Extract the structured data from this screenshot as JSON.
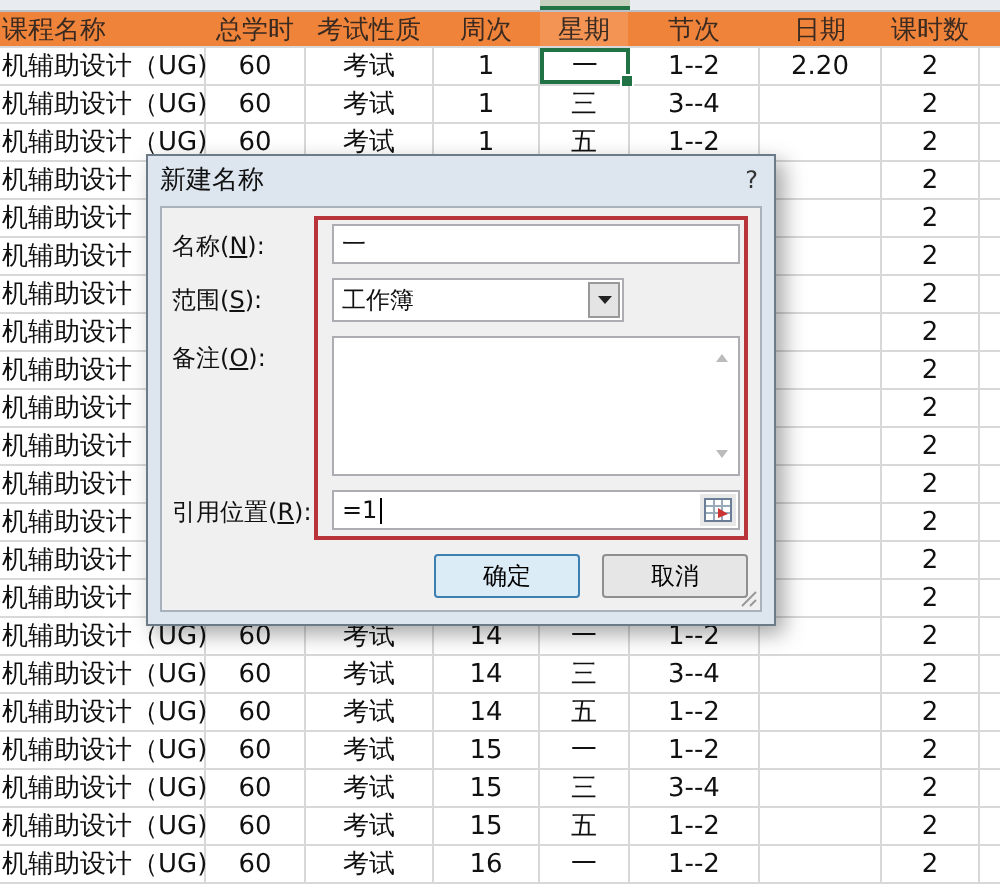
{
  "sheet": {
    "columns": [
      {
        "label": "课程名称",
        "selected": false
      },
      {
        "label": "总学时",
        "selected": false
      },
      {
        "label": "考试性质",
        "selected": false
      },
      {
        "label": "周次",
        "selected": false
      },
      {
        "label": "星期",
        "selected": true
      },
      {
        "label": "节次",
        "selected": false
      },
      {
        "label": "日期",
        "selected": false
      },
      {
        "label": "课时数",
        "selected": false
      }
    ],
    "rows": [
      {
        "kind": "full",
        "selected": true,
        "cells": [
          "机辅助设计（UG)",
          "60",
          "考试",
          "1",
          "一",
          "1--2",
          "2.20",
          "2"
        ]
      },
      {
        "kind": "full",
        "selected": false,
        "cells": [
          "机辅助设计（UG)",
          "60",
          "考试",
          "1",
          "三",
          "3--4",
          null,
          "2"
        ]
      },
      {
        "kind": "full",
        "selected": false,
        "cells": [
          "机辅助设计（UG)",
          "60",
          "考试",
          "1",
          "五",
          "1--2",
          null,
          "2"
        ]
      },
      {
        "kind": "covered",
        "selected": false,
        "cells": [
          "机辅助设计",
          "2"
        ]
      },
      {
        "kind": "covered",
        "selected": false,
        "cells": [
          "机辅助设计",
          "2"
        ]
      },
      {
        "kind": "covered",
        "selected": false,
        "cells": [
          "机辅助设计",
          "2"
        ]
      },
      {
        "kind": "covered",
        "selected": false,
        "cells": [
          "机辅助设计",
          "2"
        ]
      },
      {
        "kind": "covered",
        "selected": false,
        "cells": [
          "机辅助设计",
          "2"
        ]
      },
      {
        "kind": "covered",
        "selected": false,
        "cells": [
          "机辅助设计",
          "2"
        ]
      },
      {
        "kind": "covered",
        "selected": false,
        "cells": [
          "机辅助设计",
          "2"
        ]
      },
      {
        "kind": "covered",
        "selected": false,
        "cells": [
          "机辅助设计",
          "2"
        ]
      },
      {
        "kind": "covered",
        "selected": false,
        "cells": [
          "机辅助设计",
          "2"
        ]
      },
      {
        "kind": "covered",
        "selected": false,
        "cells": [
          "机辅助设计",
          "2"
        ]
      },
      {
        "kind": "covered",
        "selected": false,
        "cells": [
          "机辅助设计",
          "2"
        ]
      },
      {
        "kind": "covered",
        "selected": false,
        "cells": [
          "机辅助设计",
          "2"
        ]
      },
      {
        "kind": "full",
        "selected": false,
        "cells": [
          "机辅助设计（UG)",
          "60",
          "考试",
          "14",
          "一",
          "1--2",
          null,
          "2"
        ]
      },
      {
        "kind": "full",
        "selected": false,
        "cells": [
          "机辅助设计（UG)",
          "60",
          "考试",
          "14",
          "三",
          "3--4",
          null,
          "2"
        ]
      },
      {
        "kind": "full",
        "selected": false,
        "cells": [
          "机辅助设计（UG)",
          "60",
          "考试",
          "14",
          "五",
          "1--2",
          null,
          "2"
        ]
      },
      {
        "kind": "full",
        "selected": false,
        "cells": [
          "机辅助设计（UG)",
          "60",
          "考试",
          "15",
          "一",
          "1--2",
          null,
          "2"
        ]
      },
      {
        "kind": "full",
        "selected": false,
        "cells": [
          "机辅助设计（UG)",
          "60",
          "考试",
          "15",
          "三",
          "3--4",
          null,
          "2"
        ]
      },
      {
        "kind": "full",
        "selected": false,
        "cells": [
          "机辅助设计（UG)",
          "60",
          "考试",
          "15",
          "五",
          "1--2",
          null,
          "2"
        ]
      },
      {
        "kind": "full",
        "selected": false,
        "cells": [
          "机辅助设计（UG)",
          "60",
          "考试",
          "16",
          "一",
          "1--2",
          null,
          "2"
        ]
      }
    ]
  },
  "dialog": {
    "title": "新建名称",
    "help": "?",
    "fields": [
      {
        "kind": "text",
        "label": "名称(**N**):",
        "value": "一"
      },
      {
        "kind": "dropdown",
        "label": "范围(**S**):",
        "value": "工作簿"
      },
      {
        "kind": "textarea",
        "label": "备注(**O**):"
      },
      {
        "kind": "reference",
        "label": "引用位置(**R**):",
        "value": "=1"
      }
    ],
    "highlighted": true,
    "buttons": [
      {
        "label": "确定",
        "default": true
      },
      {
        "label": "取消",
        "default": false
      }
    ]
  }
}
